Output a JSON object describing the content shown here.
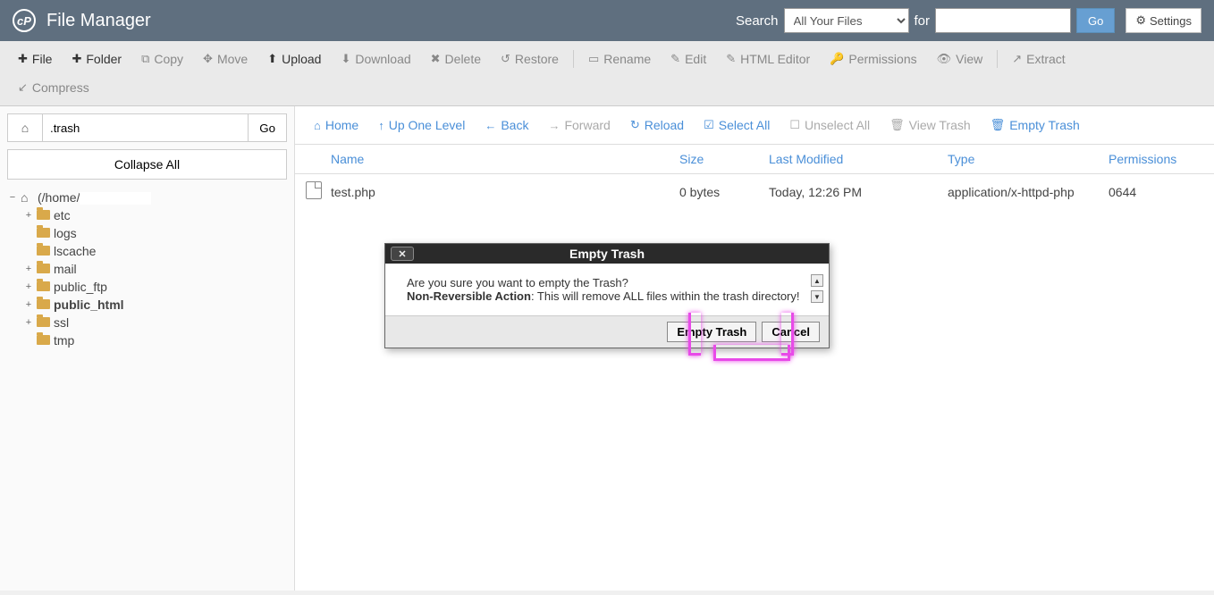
{
  "header": {
    "title": "File Manager",
    "search_label": "Search",
    "search_select": "All Your Files",
    "for_label": "for",
    "go_label": "Go",
    "settings_label": "Settings"
  },
  "toolbar": {
    "file": "File",
    "folder": "Folder",
    "copy": "Copy",
    "move": "Move",
    "upload": "Upload",
    "download": "Download",
    "delete": "Delete",
    "restore": "Restore",
    "rename": "Rename",
    "edit": "Edit",
    "html_editor": "HTML Editor",
    "permissions": "Permissions",
    "view": "View",
    "extract": "Extract",
    "compress": "Compress"
  },
  "sidebar": {
    "path_value": ".trash",
    "go_label": "Go",
    "collapse_all": "Collapse All",
    "root": "(/home/",
    "tree": [
      {
        "label": "etc",
        "toggle": "+"
      },
      {
        "label": "logs",
        "toggle": ""
      },
      {
        "label": "lscache",
        "toggle": ""
      },
      {
        "label": "mail",
        "toggle": "+"
      },
      {
        "label": "public_ftp",
        "toggle": "+"
      },
      {
        "label": "public_html",
        "toggle": "+",
        "bold": true
      },
      {
        "label": "ssl",
        "toggle": "+"
      },
      {
        "label": "tmp",
        "toggle": ""
      }
    ]
  },
  "content_toolbar": {
    "home": "Home",
    "up_one": "Up One Level",
    "back": "Back",
    "forward": "Forward",
    "reload": "Reload",
    "select_all": "Select All",
    "unselect_all": "Unselect All",
    "view_trash": "View Trash",
    "empty_trash": "Empty Trash"
  },
  "table": {
    "headers": {
      "name": "Name",
      "size": "Size",
      "modified": "Last Modified",
      "type": "Type",
      "permissions": "Permissions"
    },
    "rows": [
      {
        "name": "test.php",
        "size": "0 bytes",
        "modified": "Today, 12:26 PM",
        "type": "application/x-httpd-php",
        "permissions": "0644"
      }
    ]
  },
  "modal": {
    "title": "Empty Trash",
    "line1": "Are you sure you want to empty the Trash?",
    "bold": "Non-Reversible Action",
    "line2": ": This will remove ALL files within the trash directory!",
    "confirm": "Empty Trash",
    "cancel": "Cancel"
  }
}
